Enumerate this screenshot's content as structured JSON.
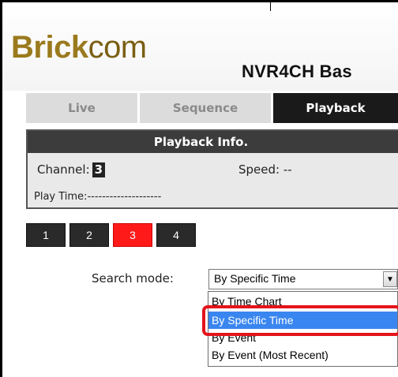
{
  "header": {
    "logo_brick": "Brick",
    "logo_com": "com",
    "product_title": "NVR4CH Bas",
    "logo_colors": {
      "brick": "#9a7a1d",
      "com": "#7a5f12"
    }
  },
  "tabs": [
    {
      "label": "Live",
      "active": false
    },
    {
      "label": "Sequence",
      "active": false
    },
    {
      "label": "Playback",
      "active": true
    }
  ],
  "playback_info": {
    "title": "Playback Info.",
    "channel_label": "Channel:",
    "channel_value": "3",
    "speed_label": "Speed:",
    "speed_value": "--",
    "play_time_label": "Play Time:",
    "play_time_value": "--------------------"
  },
  "channels": {
    "buttons": [
      "1",
      "2",
      "3",
      "4"
    ],
    "selected": "3",
    "active_color": "#ff1a1a"
  },
  "search": {
    "label": "Search mode:",
    "selected_value": "By Specific Time",
    "options": [
      "By Time Chart",
      "By Specific Time",
      "By Event",
      "By Event (Most Recent)"
    ],
    "highlight_color": "#3a86f0",
    "annotation_color": "#e4141b"
  }
}
